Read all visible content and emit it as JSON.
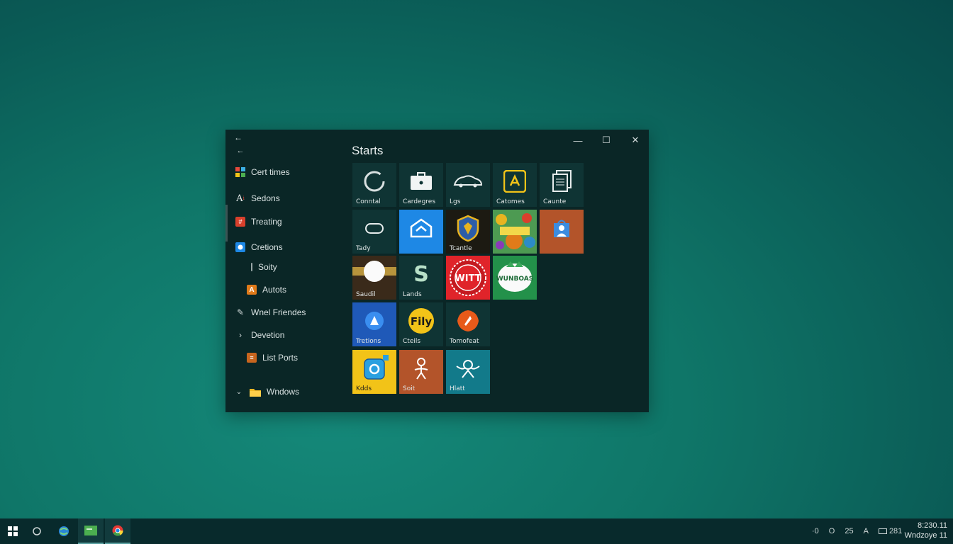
{
  "window": {
    "title": "Starts",
    "back_glyph": "←",
    "minimize_glyph": "—",
    "maximize_glyph": "☐",
    "close_glyph": "✕"
  },
  "sidebar": {
    "items": [
      {
        "label": "Cert times",
        "icon": "colorful-grid-icon"
      },
      {
        "label": "Sedons",
        "icon": "font-a-icon"
      },
      {
        "label": "Treating",
        "icon": "red-document-icon"
      },
      {
        "label": "Cretions",
        "icon": "blue-circle-icon"
      },
      {
        "label": "Soity",
        "icon": "line-icon"
      },
      {
        "label": "Autots",
        "icon": "orange-a-icon"
      },
      {
        "label": "Wnel Friendes",
        "icon": "pen-icon"
      },
      {
        "label": "Devetion",
        "icon": "chevron-right-icon"
      },
      {
        "label": "List Ports",
        "icon": "orange-doc-icon"
      },
      {
        "label": "Wndows",
        "icon": "folder-icon"
      }
    ]
  },
  "tiles": [
    {
      "label": "Conntal",
      "icon": "circle-ring-icon",
      "bg": "#0f3434"
    },
    {
      "label": "Cardegres",
      "icon": "briefcase-icon",
      "bg": "#0f3434"
    },
    {
      "label": "Lgs",
      "icon": "car-icon",
      "bg": "#0f3434"
    },
    {
      "label": "Catomes",
      "icon": "yellow-square-icon",
      "bg": "#0f3434"
    },
    {
      "label": "Caunte",
      "icon": "document-stack-icon",
      "bg": "#0f3434"
    },
    {
      "label": "Tady",
      "icon": "cloud-icon",
      "bg": "#0f3434"
    },
    {
      "label": "",
      "icon": "blue-house-icon",
      "bg": "#1e88e5"
    },
    {
      "label": "Tcantle",
      "icon": "shield-icon",
      "bg": "#2a2418"
    },
    {
      "label": "",
      "icon": "colorful-poster-icon",
      "bg": "#3d8a5a"
    },
    {
      "label": "",
      "icon": "person-bag-icon",
      "bg": "#b3542a"
    },
    {
      "label": "Saudil",
      "icon": "white-circle-icon",
      "bg": "#3a2a1a"
    },
    {
      "label": "Lands",
      "icon": "s-letter-icon",
      "bg": "#0f3434"
    },
    {
      "label": "",
      "icon": "red-badge-icon",
      "bg": "#e0242a",
      "text": "WITT"
    },
    {
      "label": "",
      "icon": "green-badge-icon",
      "bg": "#23914a",
      "text": "WUNBOAS"
    },
    {
      "label": "Tretions",
      "icon": "blue-a-icon",
      "bg": "#1f59b8"
    },
    {
      "label": "Cteils",
      "icon": "yellow-circle-icon",
      "bg": "#0f3434",
      "text": "Fily"
    },
    {
      "label": "Tomofeat",
      "icon": "orange-diamond-icon",
      "bg": "#0f3434"
    },
    {
      "label": "Kdds",
      "icon": "yellow-app-icon",
      "bg": "#f2c318"
    },
    {
      "label": "Soit",
      "icon": "figure-icon",
      "bg": "#b3542a"
    },
    {
      "label": "Hlatt",
      "icon": "wings-icon",
      "bg": "#127a8a"
    }
  ],
  "taskbar": {
    "tray_items": [
      "·0",
      "O",
      "25",
      "A",
      "281"
    ],
    "clock_time": "8:230.11",
    "clock_sub": "Wndzoye 11"
  }
}
